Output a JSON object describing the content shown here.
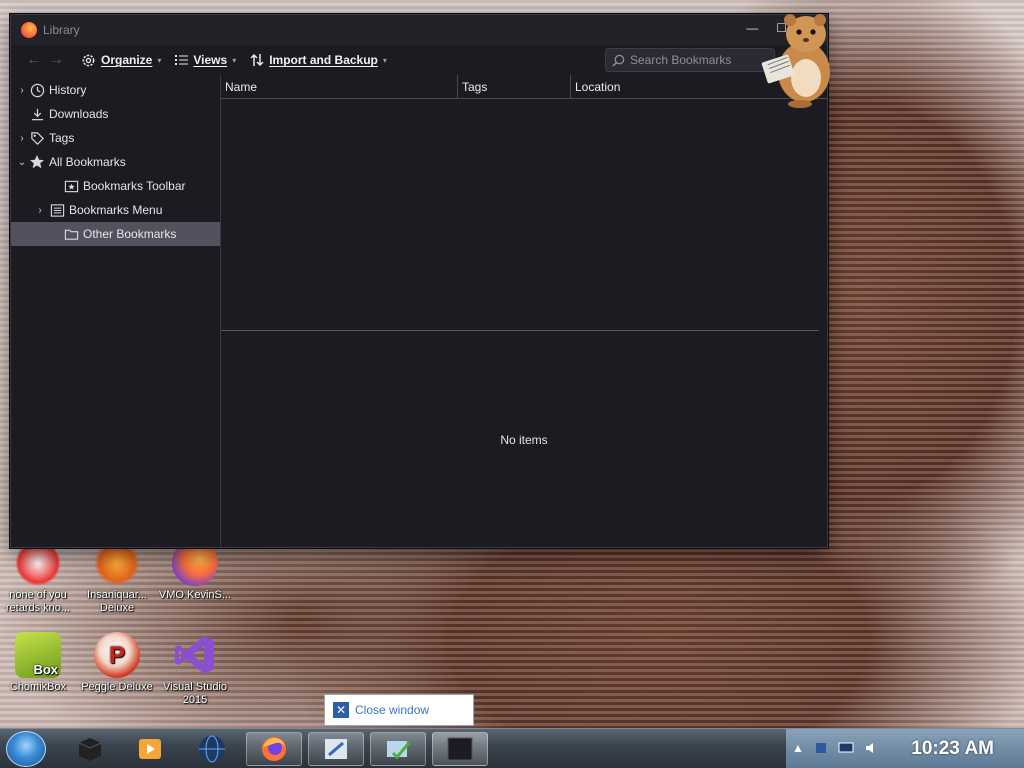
{
  "window": {
    "title": "Library",
    "controls": {
      "minimize": "—",
      "maximize": "☐"
    }
  },
  "toolbar": {
    "back_icon": "←",
    "forward_icon": "→",
    "organize_label": "Organize",
    "views_label": "Views",
    "import_label": "Import and Backup",
    "caret": "▾",
    "search_placeholder": "Search Bookmarks"
  },
  "sidebar": {
    "items": [
      {
        "label": "History",
        "icon": "clock-icon",
        "twisty": "›"
      },
      {
        "label": "Downloads",
        "icon": "download-icon",
        "twisty": ""
      },
      {
        "label": "Tags",
        "icon": "tag-icon",
        "twisty": "›"
      },
      {
        "label": "All Bookmarks",
        "icon": "star-icon",
        "twisty": "⌄"
      },
      {
        "label": "Bookmarks Toolbar",
        "icon": "toolbar-icon",
        "twisty": ""
      },
      {
        "label": "Bookmarks Menu",
        "icon": "menu-icon",
        "twisty": "›"
      },
      {
        "label": "Other Bookmarks",
        "icon": "folder-icon",
        "twisty": ""
      }
    ]
  },
  "columns": {
    "name": "Name",
    "tags": "Tags",
    "location": "Location"
  },
  "details": {
    "empty_text": "No items"
  },
  "desktop_icons": [
    {
      "label": "none of you retards kno..."
    },
    {
      "label": "Insaniquar... Deluxe"
    },
    {
      "label": "VMO KevinS..."
    },
    {
      "label": "ChomikBox"
    },
    {
      "label": "Peggle Deluxe"
    },
    {
      "label": "Visual Studio 2015"
    }
  ],
  "chomikbox_badge": "Box",
  "peggle_letter": "P",
  "tooltip": {
    "text": "Close window"
  },
  "taskbar": {
    "clock": "10:23 AM"
  },
  "colors": {
    "window_bg": "#1c1b22",
    "selected_item": "#52525e",
    "tooltip_text": "#3a77c8"
  }
}
